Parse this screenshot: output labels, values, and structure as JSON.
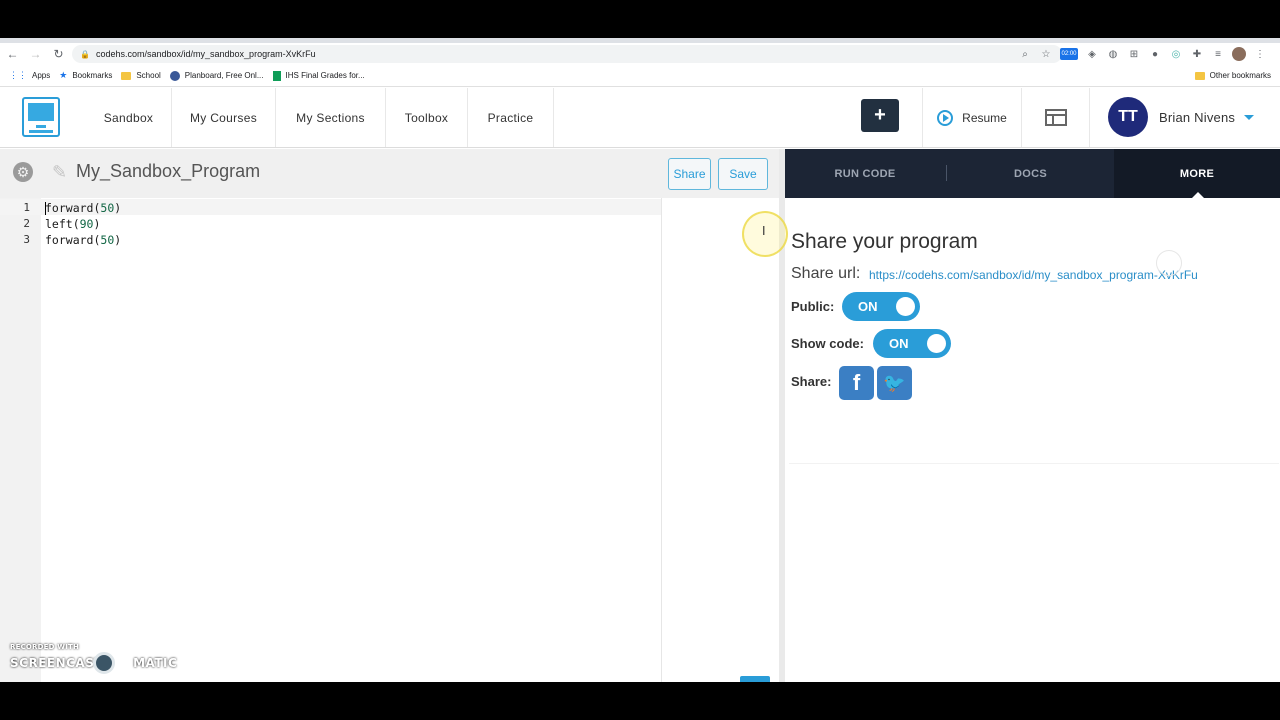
{
  "browser": {
    "url": "codehs.com/sandbox/id/my_sandbox_program-XvKrFu",
    "timer_badge": "02:00",
    "bookmarks": [
      {
        "label": "Apps",
        "icon": "apps-grid-icon"
      },
      {
        "label": "Bookmarks",
        "icon": "star-icon"
      },
      {
        "label": "School",
        "icon": "folder-icon"
      },
      {
        "label": "Planboard, Free Onl...",
        "icon": "planboard-icon"
      },
      {
        "label": "IHS Final Grades for...",
        "icon": "sheets-icon"
      }
    ],
    "other_bookmarks": "Other bookmarks"
  },
  "nav": {
    "links": [
      "Sandbox",
      "My Courses",
      "My Sections",
      "Toolbox",
      "Practice"
    ],
    "plus": "+",
    "resume": "Resume",
    "user_name": "Brian Nivens",
    "user_initials": "TT"
  },
  "editor": {
    "program_title": "My_Sandbox_Program",
    "share_button": "Share",
    "save_button": "Save",
    "lines": [
      {
        "num": "1",
        "fn": "forward(",
        "arg": "50",
        "end": ")"
      },
      {
        "num": "2",
        "fn": "left(",
        "arg": "90",
        "end": ")"
      },
      {
        "num": "3",
        "fn": "forward(",
        "arg": "50",
        "end": ")"
      }
    ]
  },
  "panel": {
    "tabs": [
      "RUN CODE",
      "DOCS",
      "MORE"
    ],
    "active_tab": "MORE",
    "title": "Share your program",
    "share_url_label": "Share url:",
    "share_url": "https://codehs.com/sandbox/id/my_sandbox_program-XvKrFu",
    "public_label": "Public:",
    "public_state": "ON",
    "show_code_label": "Show code:",
    "show_code_state": "ON",
    "share_label": "Share:",
    "facebook_glyph": "f",
    "twitter_glyph": "🐦"
  },
  "watermark": {
    "line1": "RECORDED WITH",
    "line2a": "SCREENCAST",
    "line2b": "MATIC"
  },
  "colors": {
    "accent": "#2a9dd8",
    "panel_dark": "#1c2535",
    "toggle_on": "#2a9dd8",
    "social": "#3b7fc4"
  }
}
